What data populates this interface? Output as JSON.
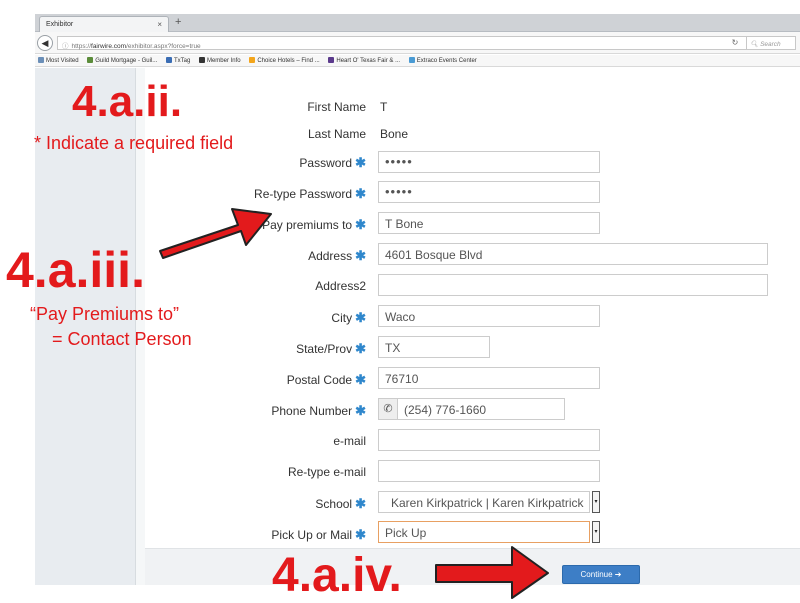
{
  "browser": {
    "tab_title": "Exhibitor",
    "tab_close": "×",
    "new_tab": "+",
    "url_prefix": "https://",
    "url_domain": "fairwire.com",
    "url_path": "/exhibitor.aspx?force=true",
    "search_placeholder": "Search",
    "bookmarks": [
      {
        "label": "Most Visited",
        "color": "#6b8fb8"
      },
      {
        "label": "Guild Mortgage - Guil...",
        "color": "#5b8c3a"
      },
      {
        "label": "TxTag",
        "color": "#3a6db4"
      },
      {
        "label": "Member Info",
        "color": "#333333"
      },
      {
        "label": "Choice Hotels – Find ...",
        "color": "#f3a51b"
      },
      {
        "label": "Heart O' Texas Fair & ...",
        "color": "#5b3a8c"
      },
      {
        "label": "Extraco Events Center",
        "color": "#4a9bd4"
      }
    ]
  },
  "form": {
    "first_name": {
      "label": "First Name",
      "value": "T"
    },
    "last_name": {
      "label": "Last Name",
      "value": "Bone"
    },
    "password": {
      "label": "Password",
      "value": "•••••"
    },
    "retype_password": {
      "label": "Re-type Password",
      "value": "•••••"
    },
    "pay_premiums_to": {
      "label": "Pay premiums to",
      "value": "T Bone"
    },
    "address": {
      "label": "Address",
      "value": "4601 Bosque Blvd"
    },
    "address2": {
      "label": "Address2",
      "value": ""
    },
    "city": {
      "label": "City",
      "value": "Waco"
    },
    "state": {
      "label": "State/Prov",
      "value": "TX"
    },
    "postal_code": {
      "label": "Postal Code",
      "value": "76710"
    },
    "phone": {
      "label": "Phone Number",
      "value": "(254) 776-1660"
    },
    "email": {
      "label": "e-mail",
      "value": ""
    },
    "retype_email": {
      "label": "Re-type e-mail",
      "value": ""
    },
    "school": {
      "label": "School",
      "value": "Karen Kirkpatrick | Karen Kirkpatrick"
    },
    "pickup_or_mail": {
      "label": "Pick Up or Mail",
      "value": "Pick Up"
    },
    "required_marker": "✱",
    "continue_label": "Continue"
  },
  "annotations": {
    "step_ii": "4.a.ii.",
    "step_ii_note": "* Indicate a required field",
    "step_iii": "4.a.iii.",
    "step_iii_note_1": "“Pay Premiums to”",
    "step_iii_note_2": "= Contact Person",
    "step_iv": "4.a.iv."
  },
  "colors": {
    "required_marker": "#2f87cc",
    "annotation_red": "#e31a1c",
    "continue_button": "#3d7ec6"
  }
}
